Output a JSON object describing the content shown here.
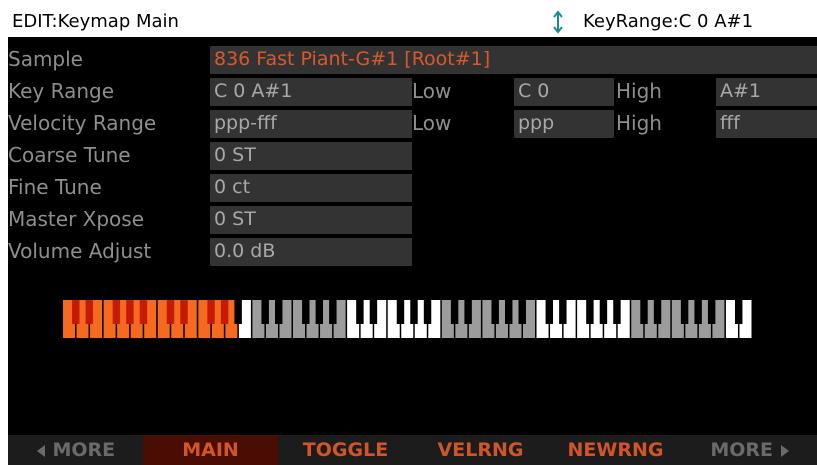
{
  "header": {
    "title": "EDIT:Keymap Main",
    "status_icon": "up-down-arrow-icon",
    "status": "KeyRange:C 0 A#1"
  },
  "params": {
    "sample": {
      "label": "Sample",
      "value": "836 Fast Piant-G#1 [Root#1]"
    },
    "key_range": {
      "label": "Key Range",
      "value": "C 0 A#1",
      "low_label": "Low",
      "low": "C 0",
      "high_label": "High",
      "high": "A#1"
    },
    "velocity_range": {
      "label": "Velocity Range",
      "value": "ppp-fff",
      "low_label": "Low",
      "low": "ppp",
      "high_label": "High",
      "high": "fff"
    },
    "coarse_tune": {
      "label": "Coarse Tune",
      "value": "0 ST"
    },
    "fine_tune": {
      "label": "Fine Tune",
      "value": "0 ct"
    },
    "master_xpose": {
      "label": "Master Xpose",
      "value": "0 ST"
    },
    "volume_adjust": {
      "label": "Volume Adjust",
      "value": "0.0 dB"
    }
  },
  "keyboard": {
    "octaves": 7,
    "extra_white_keys": 2,
    "selected_range_white_keys": 13,
    "colors": {
      "selected": "#f56a1e",
      "selected_black": "#c51a04",
      "white": "#ffffff",
      "grey": "#9c9c9c",
      "black": "#000000"
    }
  },
  "softkeys": [
    {
      "label": "MORE",
      "arrow": "left-triangle-icon",
      "active": false
    },
    {
      "label": "MAIN",
      "active": true
    },
    {
      "label": "TOGGLE",
      "active": false
    },
    {
      "label": "VELRNG",
      "active": false
    },
    {
      "label": "NEWRNG",
      "active": false
    },
    {
      "label": "MORE",
      "arrow": "right-triangle-icon",
      "active": false
    }
  ],
  "colors": {
    "accent": "#d9592d",
    "active_tab_bg": "#4a0d04",
    "field_bg": "#333333"
  }
}
